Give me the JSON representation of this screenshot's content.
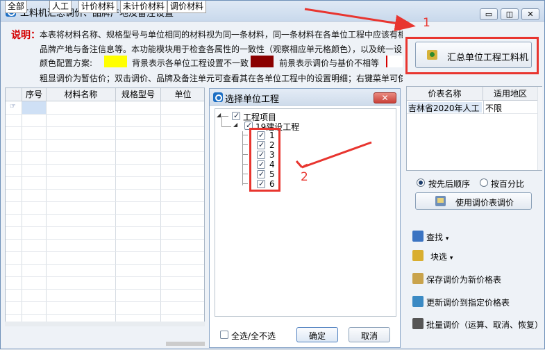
{
  "window": {
    "title": "工料机汇总调价、品牌产地及备注设置",
    "controls": [
      "▭",
      "◫",
      "✕"
    ]
  },
  "description": {
    "label": "说明：",
    "line1": "本表将材料名称、规格型号与单位相同的材料视为同一条材料，同一条材料在各单位工程中应该有相",
    "line2": "品牌产地与备注信息等。本功能模块用于检查各属性的一致性（观察相应单元格颜色），以及统一设",
    "scheme_label": "颜色配置方案:",
    "bg_text": "背景表示各单位工程设置不一致",
    "fg_text": "前景表示调价与基价不相等",
    "line4": "粗显调价为暂估价；双击调价、品牌及备注单元可查看其在各单位工程中的设置明细；右键菜单可使",
    "colors": {
      "inconsistent_bg": "#ffff00",
      "price_diff_fg": "#8b0000"
    }
  },
  "summarize_button": "汇总单位工程工料机",
  "price_table": {
    "headers": [
      "价表名称",
      "适用地区"
    ],
    "rows": [
      {
        "name": "吉林省2020年人工",
        "region": "不限"
      }
    ]
  },
  "sort_options": {
    "option1": "按先后顺序",
    "option2": "按百分比",
    "selected": "option1"
  },
  "use_price_button": "使用调价表调价",
  "actions": {
    "search": "查找",
    "block_select": "块选",
    "save_as_table": "保存调价为新价格表",
    "update_table": "更新调价到指定价格表",
    "batch": "批量调价（运算、取消、恢复）"
  },
  "grid": {
    "headers": [
      "序号",
      "材料名称",
      "规格型号",
      "单位"
    ]
  },
  "tabs": [
    "全部",
    "人工",
    "计价材料",
    "未计价材料",
    "调价材料"
  ],
  "dialog": {
    "title": "选择单位工程",
    "close": "✕",
    "tree": {
      "root": "工程项目",
      "child": "19建设工程",
      "leaves": [
        "1",
        "2",
        "3",
        "4",
        "5",
        "6"
      ]
    },
    "select_all": "全选/全不选",
    "ok": "确定",
    "cancel": "取消"
  },
  "annotations": {
    "marker1": "1",
    "marker2": "2"
  }
}
